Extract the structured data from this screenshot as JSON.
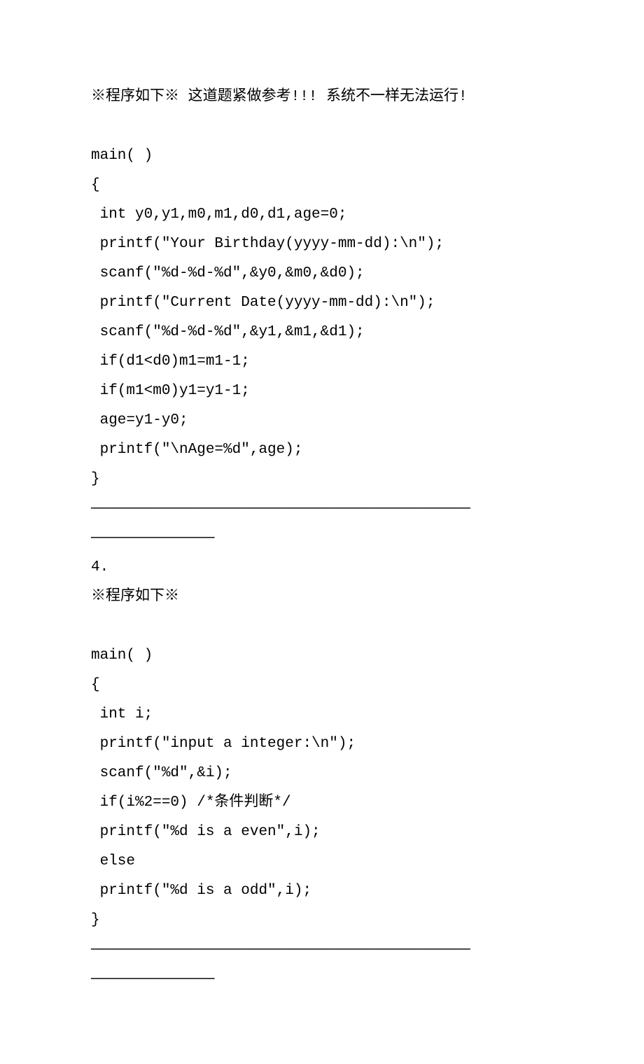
{
  "lines": [
    "※程序如下※ 这道题紧做参考!!! 系统不一样无法运行!",
    "",
    "main( )",
    "{",
    " int y0,y1,m0,m1,d0,d1,age=0;",
    " printf(\"Your Birthday(yyyy-mm-dd):\\n\");",
    " scanf(\"%d-%d-%d\",&y0,&m0,&d0);",
    " printf(\"Current Date(yyyy-mm-dd):\\n\");",
    " scanf(\"%d-%d-%d\",&y1,&m1,&d1);",
    " if(d1<d0)m1=m1-1;",
    " if(m1<m0)y1=y1-1;",
    " age=y1-y0;",
    " printf(\"\\nAge=%d\",age);",
    "}",
    "———————————————————————————————————————————",
    "——————————————",
    "4.",
    "※程序如下※",
    "",
    "main( )",
    "{",
    " int i;",
    " printf(\"input a integer:\\n\");",
    " scanf(\"%d\",&i);",
    " if(i%2==0) /*条件判断*/",
    " printf(\"%d is a even\",i);",
    " else",
    " printf(\"%d is a odd\",i);",
    "}",
    "———————————————————————————————————————————",
    "——————————————"
  ]
}
